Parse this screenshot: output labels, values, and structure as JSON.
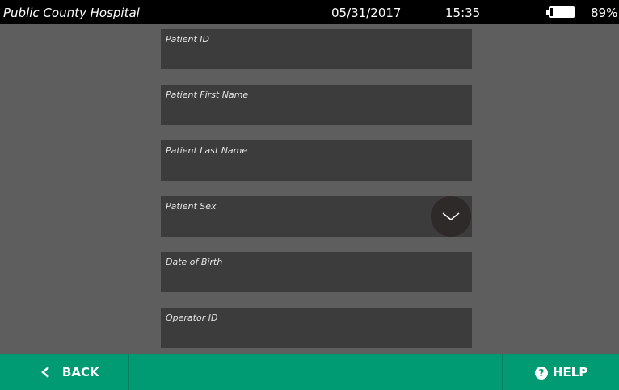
{
  "status": {
    "facility": "Public County Hospital",
    "date": "05/31/2017",
    "time": "15:35",
    "battery_percent_label": "89%",
    "battery_level": 0.89
  },
  "form": {
    "fields": [
      {
        "label": "Patient ID"
      },
      {
        "label": "Patient First Name"
      },
      {
        "label": "Patient Last Name"
      },
      {
        "label": "Patient Sex"
      },
      {
        "label": "Date of Birth"
      },
      {
        "label": "Operator ID"
      }
    ]
  },
  "footer": {
    "back_label": "BACK",
    "help_label": "HELP",
    "help_icon_glyph": "?"
  },
  "colors": {
    "accent": "#009a73",
    "background": "#5e5e5e",
    "field": "#3c3c3c"
  },
  "icons": {
    "back": "chevron-left-icon",
    "help": "help-circle-icon",
    "dropdown": "chevron-down-icon",
    "battery": "battery-icon"
  }
}
